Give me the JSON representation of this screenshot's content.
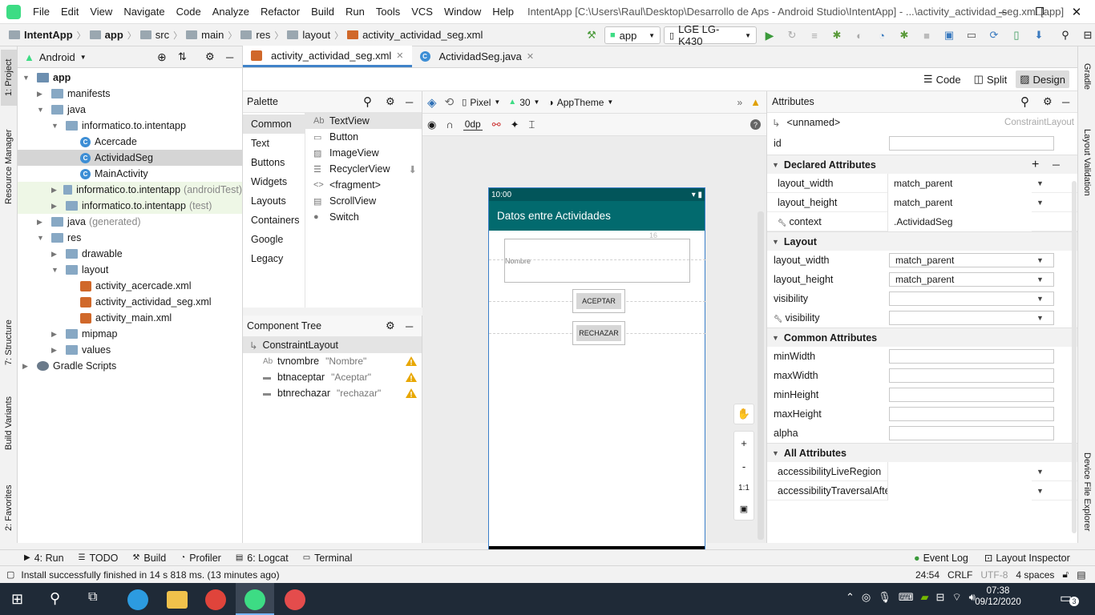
{
  "menu": [
    "File",
    "Edit",
    "View",
    "Navigate",
    "Code",
    "Analyze",
    "Refactor",
    "Build",
    "Run",
    "Tools",
    "VCS",
    "Window",
    "Help"
  ],
  "window_title": "IntentApp [C:\\Users\\Raul\\Desktop\\Desarrollo de Aps  - Android Studio\\IntentApp] - ...\\activity_actividad_seg.xml [app]",
  "breadcrumb": [
    "IntentApp",
    "app",
    "src",
    "main",
    "res",
    "layout",
    "activity_actividad_seg.xml"
  ],
  "run_config": "app",
  "device": "LGE LG-K430",
  "project_view": "Android",
  "tree": [
    {
      "label": "app",
      "level": 0,
      "type": "module",
      "open": true
    },
    {
      "label": "manifests",
      "level": 1,
      "type": "folder",
      "open": false
    },
    {
      "label": "java",
      "level": 1,
      "type": "folder",
      "open": true
    },
    {
      "label": "informatico.to.intentapp",
      "level": 2,
      "type": "folder",
      "open": true
    },
    {
      "label": "Acercade",
      "level": 3,
      "type": "class"
    },
    {
      "label": "ActividadSeg",
      "level": 3,
      "type": "class",
      "selected": true
    },
    {
      "label": "MainActivity",
      "level": 3,
      "type": "class"
    },
    {
      "label": "informatico.to.intentapp",
      "suffix": "(androidTest)",
      "level": 2,
      "type": "folder",
      "open": false,
      "green": true
    },
    {
      "label": "informatico.to.intentapp",
      "suffix": "(test)",
      "level": 2,
      "type": "folder",
      "open": false,
      "green": true
    },
    {
      "label": "java",
      "suffix": "(generated)",
      "level": 1,
      "type": "folder",
      "open": false
    },
    {
      "label": "res",
      "level": 1,
      "type": "folder",
      "open": true
    },
    {
      "label": "drawable",
      "level": 2,
      "type": "folder",
      "open": false
    },
    {
      "label": "layout",
      "level": 2,
      "type": "folder",
      "open": true
    },
    {
      "label": "activity_acercade.xml",
      "level": 3,
      "type": "xml"
    },
    {
      "label": "activity_actividad_seg.xml",
      "level": 3,
      "type": "xml"
    },
    {
      "label": "activity_main.xml",
      "level": 3,
      "type": "xml"
    },
    {
      "label": "mipmap",
      "level": 2,
      "type": "folder",
      "open": false
    },
    {
      "label": "values",
      "level": 2,
      "type": "folder",
      "open": false
    },
    {
      "label": "Gradle Scripts",
      "level": 0,
      "type": "gradle",
      "open": false
    }
  ],
  "editor_tabs": [
    {
      "label": "activity_actividad_seg.xml",
      "active": true
    },
    {
      "label": "ActividadSeg.java",
      "active": false
    }
  ],
  "modes": [
    "Code",
    "Split",
    "Design"
  ],
  "palette": {
    "title": "Palette",
    "categories": [
      "Common",
      "Text",
      "Buttons",
      "Widgets",
      "Layouts",
      "Containers",
      "Google",
      "Legacy"
    ],
    "items": [
      "TextView",
      "Button",
      "ImageView",
      "RecyclerView",
      "<fragment>",
      "ScrollView",
      "Switch"
    ]
  },
  "design_toolbar": {
    "device": "Pixel",
    "api": "30",
    "theme": "AppTheme",
    "margin": "0dp"
  },
  "component_tree": {
    "title": "Component Tree",
    "root": "ConstraintLayout",
    "items": [
      {
        "name": "tvnombre",
        "text": "\"Nombre\""
      },
      {
        "name": "btnaceptar",
        "text": "\"Aceptar\""
      },
      {
        "name": "btnrechazar",
        "text": "\"rechazar\""
      }
    ]
  },
  "phone": {
    "time": "10:00",
    "app_title": "Datos entre Actividades",
    "textview_text": "Nombre",
    "margin_label": "16",
    "button1": "ACEPTAR",
    "button2": "RECHAZAR"
  },
  "zoom_controls": [
    "+",
    "-",
    "1:1"
  ],
  "attributes": {
    "title": "Attributes",
    "component": "<unnamed>",
    "component_type": "ConstraintLayout",
    "id_label": "id",
    "declared": {
      "title": "Declared Attributes",
      "rows": [
        {
          "name": "layout_width",
          "value": "match_parent",
          "dropdown": true
        },
        {
          "name": "layout_height",
          "value": "match_parent",
          "dropdown": true
        },
        {
          "name": "context",
          "value": ".ActividadSeg",
          "dropdown": false,
          "tool": true
        }
      ]
    },
    "layout": {
      "title": "Layout",
      "rows": [
        {
          "name": "layout_width",
          "value": "match_parent",
          "dropdown": true
        },
        {
          "name": "layout_height",
          "value": "match_parent",
          "dropdown": true
        },
        {
          "name": "visibility",
          "value": "",
          "dropdown": true
        },
        {
          "name": "visibility",
          "value": "",
          "dropdown": true,
          "tool": true
        }
      ]
    },
    "common": {
      "title": "Common Attributes",
      "rows": [
        {
          "name": "minWidth",
          "value": ""
        },
        {
          "name": "maxWidth",
          "value": ""
        },
        {
          "name": "minHeight",
          "value": ""
        },
        {
          "name": "maxHeight",
          "value": ""
        },
        {
          "name": "alpha",
          "value": ""
        }
      ]
    },
    "all": {
      "title": "All Attributes",
      "rows": [
        {
          "name": "accessibilityLiveRegion",
          "value": "",
          "dropdown": true
        },
        {
          "name": "accessibilityTraversalAfter",
          "value": "",
          "dropdown": true
        }
      ]
    }
  },
  "left_strip": [
    "1: Project",
    "Resource Manager",
    "7: Structure",
    "Build Variants",
    "2: Favorites"
  ],
  "right_strip": [
    "Gradle",
    "Layout Validation",
    "Device File Explorer"
  ],
  "tool_windows": [
    "4: Run",
    "TODO",
    "Build",
    "Profiler",
    "6: Logcat",
    "Terminal"
  ],
  "tool_windows_right": [
    "Event Log",
    "Layout Inspector"
  ],
  "status": {
    "message": "Install successfully finished in 14 s 818 ms. (13 minutes ago)",
    "position": "24:54",
    "line_sep": "CRLF",
    "encoding": "UTF-8",
    "indent": "4 spaces"
  },
  "taskbar": {
    "time": "07:38",
    "date": "09/12/2020",
    "notifications": "3"
  }
}
